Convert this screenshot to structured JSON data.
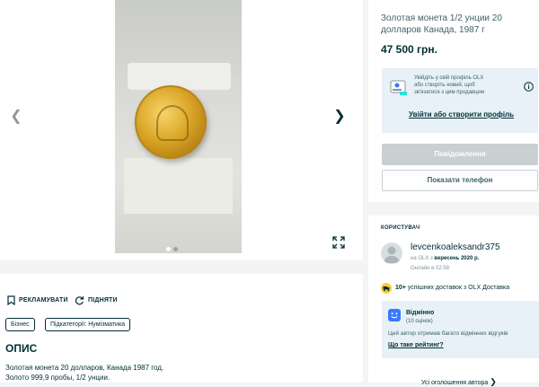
{
  "gallery": {
    "prev_icon": "chevron-left-icon",
    "next_icon": "chevron-right-icon",
    "expand_icon": "expand-icon",
    "dots": [
      {
        "active": true
      },
      {
        "active": false
      }
    ],
    "colors": {
      "dot_active": "#ffffff",
      "dot_inactive": "#9aa2a2"
    }
  },
  "actions": {
    "promote_label": "РЕКЛАМУВАТИ",
    "promote_icon": "bookmark-icon",
    "raise_label": "ПІДНЯТИ",
    "raise_icon": "refresh-icon"
  },
  "tags": [
    "Бізнес",
    "Підкатегорії: Нумізматика"
  ],
  "description": {
    "heading": "ОПИС",
    "lines": [
      "Золотая монета 20 долларов, Канада 1987 год.",
      "Золото 999,9 пробы, 1/2 унции."
    ]
  },
  "listing": {
    "title_line1": "Золотая монета 1/2 унции 20",
    "title_line2": "долларов Канада, 1987 г",
    "price": "47 500 грн."
  },
  "notice": {
    "text_line1": "Увійдіть у свій профіль OLX",
    "text_line2": "або створіть новий, щоб",
    "text_line3": "зв'язатися з цим продавцем",
    "link": "Увійти або створити профіль",
    "info_icon": "info-icon",
    "illustration_icon": "profile-card-icon"
  },
  "buttons": {
    "message": "Повідомлення",
    "phone": "Показати телефон"
  },
  "user": {
    "section_label": "КОРИСТУВАЧ",
    "name": "levcenkoaleksandr375",
    "since_prefix": "на OLX з ",
    "since_date": "вересень 2020 р.",
    "online": "Онлайн в 02:58",
    "avatar_icon": "user-avatar-icon"
  },
  "deliveries": {
    "count": "10+",
    "text": " успішних доставок з OLX Доставка",
    "icon": "delivery-truck-icon"
  },
  "rating": {
    "title": "Відмінно",
    "subtitle": "(10 оцінок)",
    "text": "Цей автор отримав багато відмінних відгуків",
    "link": "Що таке рейтинг?",
    "icon": "smile-badge-icon"
  },
  "all_ads": {
    "label": "Усі оголошення автора",
    "icon": "chevron-right-icon"
  },
  "colors": {
    "brand": "#002f34",
    "accent_yellow": "#ffce32",
    "light_blue": "#e8f1f8",
    "rating_blue": "#3a77ff"
  }
}
